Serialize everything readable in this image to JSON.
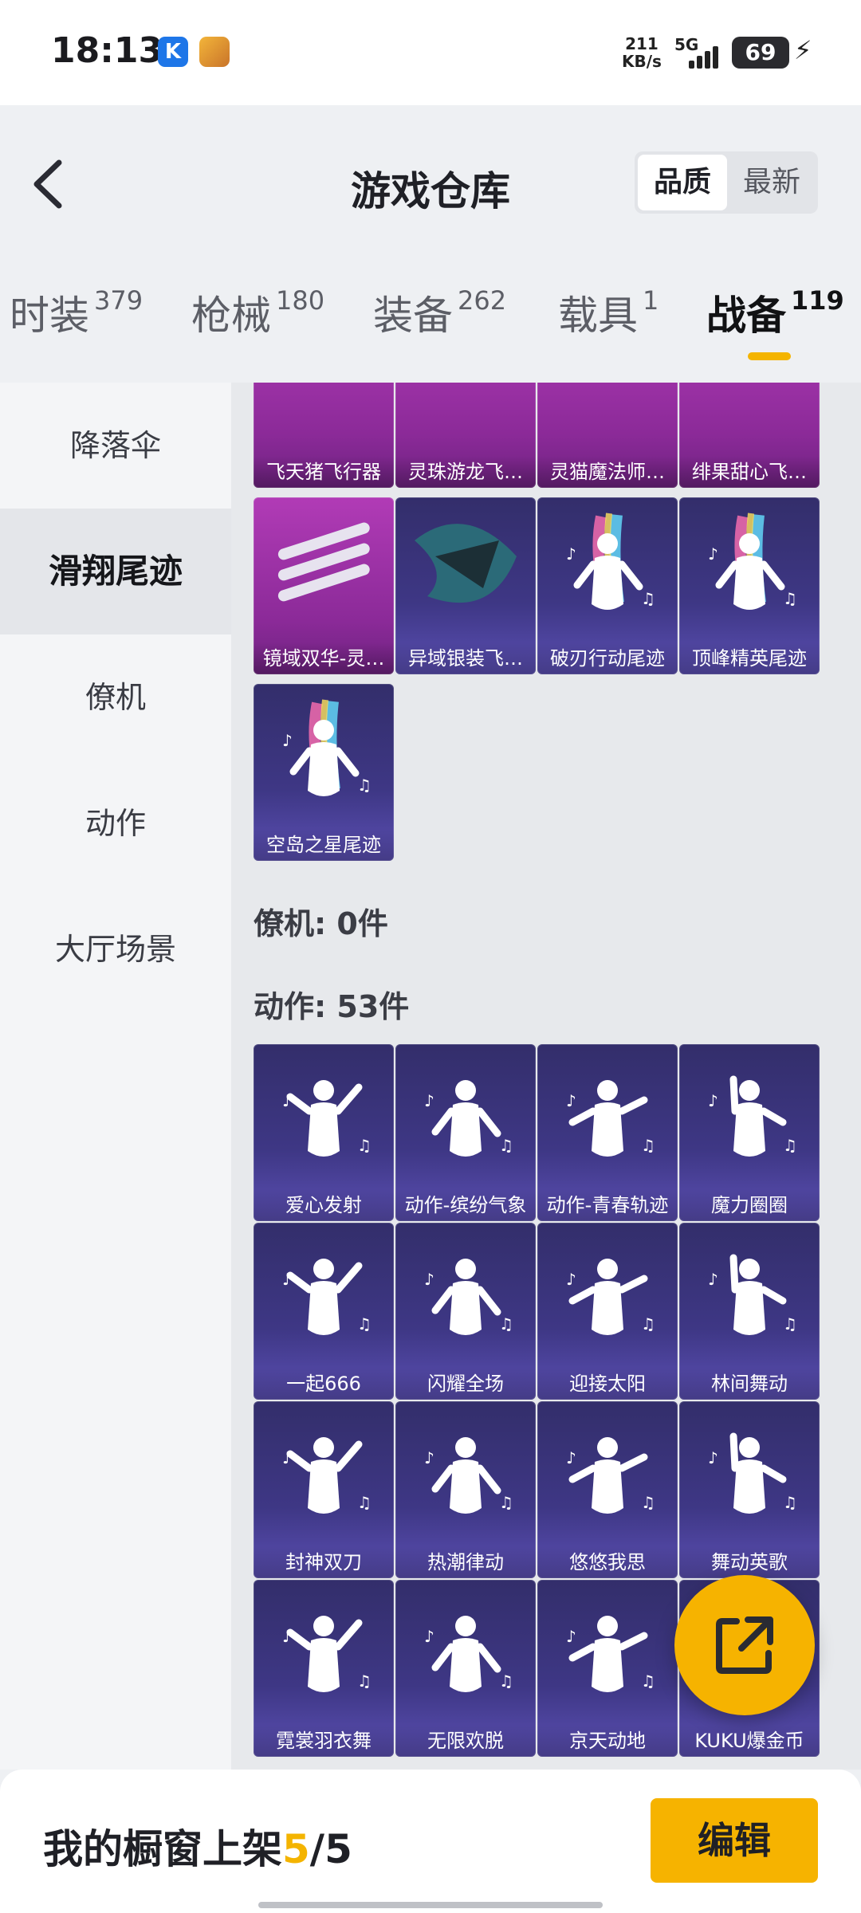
{
  "status_bar": {
    "time": "18:13",
    "net_speed": "211",
    "net_unit": "KB/s",
    "network": "5G",
    "battery": "69",
    "app1_letter": "K",
    "app1_icon": "k-app-icon",
    "app2_icon": "game-app-icon",
    "signal_icon": "signal-icon",
    "charging_icon": "bolt-icon"
  },
  "header": {
    "title": "游戏仓库",
    "back_icon": "chevron-left-icon",
    "sort_options": [
      "品质",
      "最新"
    ],
    "sort_selected": "品质"
  },
  "tabs": [
    {
      "label": "时装",
      "count": "379"
    },
    {
      "label": "枪械",
      "count": "180"
    },
    {
      "label": "装备",
      "count": "262"
    },
    {
      "label": "载具",
      "count": "1"
    },
    {
      "label": "战备",
      "count": "119",
      "active": true
    }
  ],
  "sidebar": {
    "items": [
      {
        "label": "降落伞"
      },
      {
        "label": "滑翔尾迹",
        "selected": true
      },
      {
        "label": "僚机"
      },
      {
        "label": "动作"
      },
      {
        "label": "大厅场景"
      }
    ]
  },
  "glide_items": [
    {
      "name": "飞天猪飞行器",
      "rarity": "purple"
    },
    {
      "name": "灵珠游龙飞…",
      "rarity": "purple"
    },
    {
      "name": "灵猫魔法师…",
      "rarity": "purple"
    },
    {
      "name": "绯果甜心飞…",
      "rarity": "purple"
    },
    {
      "name": "镜域双华-灵…",
      "rarity": "purple"
    },
    {
      "name": "异域银装飞…",
      "rarity": "blue"
    },
    {
      "name": "破刃行动尾迹",
      "rarity": "blue"
    },
    {
      "name": "顶峰精英尾迹",
      "rarity": "blue"
    },
    {
      "name": "空岛之星尾迹",
      "rarity": "blue"
    }
  ],
  "wingman_section": {
    "label": "僚机: 0件"
  },
  "emote_section": {
    "label": "动作: 53件"
  },
  "emote_items": [
    {
      "name": "爱心发射"
    },
    {
      "name": "动作-缤纷气象"
    },
    {
      "name": "动作-青春轨迹"
    },
    {
      "name": "魔力圈圈"
    },
    {
      "name": "一起666"
    },
    {
      "name": "闪耀全场"
    },
    {
      "name": "迎接太阳"
    },
    {
      "name": "林间舞动"
    },
    {
      "name": "封神双刀"
    },
    {
      "name": "热潮律动"
    },
    {
      "name": "悠悠我思"
    },
    {
      "name": "舞动英歌"
    },
    {
      "name": "霓裳羽衣舞"
    },
    {
      "name": "无限欢脱"
    },
    {
      "name": "京天动地"
    },
    {
      "name": "KUKU爆金币"
    }
  ],
  "fab": {
    "icon": "share-external-icon"
  },
  "footer": {
    "label": "我的橱窗上架",
    "current": "5",
    "separator": "/",
    "max": "5",
    "edit_button": "编辑"
  },
  "colors": {
    "accent": "#f6b300",
    "purple_rarity": "#b13bb6",
    "blue_rarity": "#3e3785"
  }
}
